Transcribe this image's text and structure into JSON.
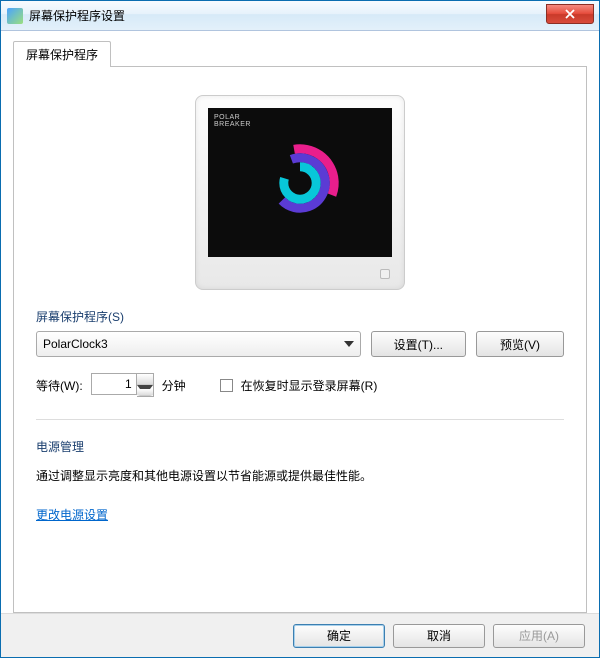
{
  "window": {
    "title": "屏幕保护程序设置"
  },
  "tab": {
    "label": "屏幕保护程序"
  },
  "saver": {
    "section_label": "屏幕保护程序(S)",
    "selected": "PolarClock3",
    "settings_btn": "设置(T)...",
    "preview_btn": "预览(V)",
    "preview_brand": "POLAR\nBREAKER"
  },
  "wait": {
    "label": "等待(W):",
    "value": "1",
    "unit": "分钟",
    "resume_label": "在恢复时显示登录屏幕(R)"
  },
  "power": {
    "title": "电源管理",
    "text": "通过调整显示亮度和其他电源设置以节省能源或提供最佳性能。",
    "link": "更改电源设置"
  },
  "buttons": {
    "ok": "确定",
    "cancel": "取消",
    "apply": "应用(A)"
  }
}
